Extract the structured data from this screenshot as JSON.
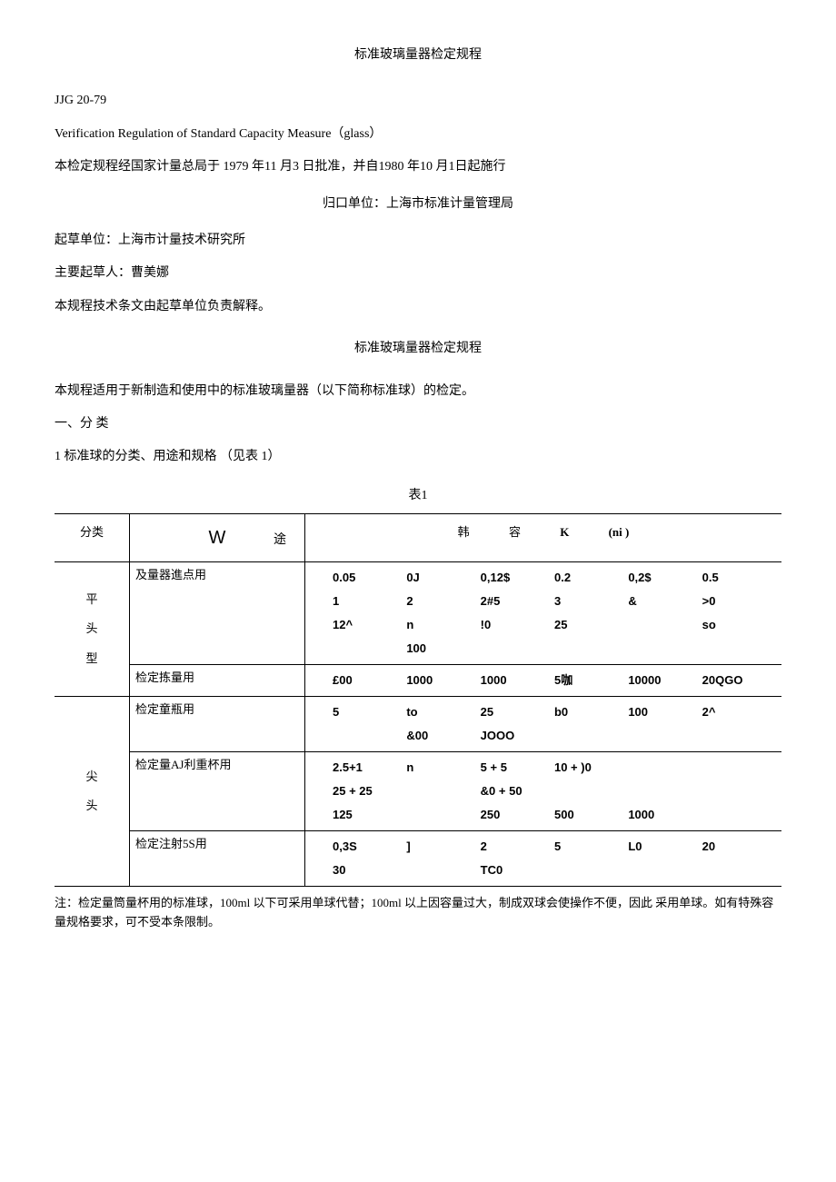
{
  "doc": {
    "title": "标准玻璃量器检定规程",
    "code": "JJG 20-79",
    "english_title": "Verification Regulation of Standard Capacity Measure（glass）",
    "approval": "本检定规程经国家计量总局于 1979 年11 月3 日批准，并自1980 年10 月1日起施行",
    "guikou": "归口单位：上海市标准计量管理局",
    "qicao_unit": "起草单位：上海市计量技术研究所",
    "qicao_person": "主要起草人：曹美娜",
    "explain": "本规程技术条文由起草单位负责解释。",
    "section_title": "标准玻璃量器检定规程",
    "scope": "本规程适用于新制造和使用中的标准玻璃量器（以下简称标准球）的检定。",
    "section1_heading": "一、分 类",
    "section1_item1": "1 标准球的分类、用途和规格 （见表 1）",
    "table_caption": "表1"
  },
  "table": {
    "headers": {
      "category": "分类",
      "use_big": "W",
      "use_sub": "途",
      "values_han": "韩",
      "values_rong": "容",
      "values_k": "K",
      "values_ni": "(ni )"
    },
    "rows": [
      {
        "category_lines": [
          "平",
          "头",
          "型"
        ],
        "subrows": [
          {
            "use": "及量器進点用",
            "value_rows": [
              [
                "0.05",
                "0J",
                "0,12$",
                "0.2",
                "0,2$",
                "0.5"
              ],
              [
                "1",
                "2",
                "2#5",
                "3",
                "&",
                ">0"
              ],
              [
                "12^",
                "n",
                "!0",
                "25",
                "",
                "so"
              ],
              [
                "",
                "100",
                "",
                "",
                "",
                ""
              ]
            ]
          },
          {
            "use": "检定拣量用",
            "value_rows": [
              [
                "£00",
                "1000",
                "1000",
                "5咖",
                "10000",
                "20QGO"
              ]
            ]
          }
        ]
      },
      {
        "category_lines": [
          "尖",
          "头"
        ],
        "subrows": [
          {
            "use": "检定童瓶用",
            "value_rows": [
              [
                "5",
                "to",
                "25",
                "b0",
                "100",
                "2^"
              ],
              [
                "",
                "&00",
                "JOOO",
                "",
                "",
                ""
              ]
            ]
          },
          {
            "use": "检定量AJ利重杯用",
            "value_rows": [
              [
                "2.5+1",
                "n",
                "5 + 5",
                "10 + )0",
                "",
                ""
              ],
              [
                "25 + 25",
                "",
                "&0 + 50",
                "",
                "",
                ""
              ],
              [
                "125",
                "",
                "250",
                "500",
                "1000",
                ""
              ]
            ]
          },
          {
            "use": "检定注射5S用",
            "value_rows": [
              [
                "0,3S",
                "]",
                "2",
                "5",
                "L0",
                "20"
              ],
              [
                "30",
                "",
                "TC0",
                "",
                "",
                ""
              ]
            ]
          }
        ]
      }
    ],
    "note": "注：检定量筒量杯用的标准球，100ml 以下可采用单球代替；100ml 以上因容量过大，制成双球会使操作不便，因此 采用单球。如有特殊容量规格要求，可不受本条限制。"
  }
}
